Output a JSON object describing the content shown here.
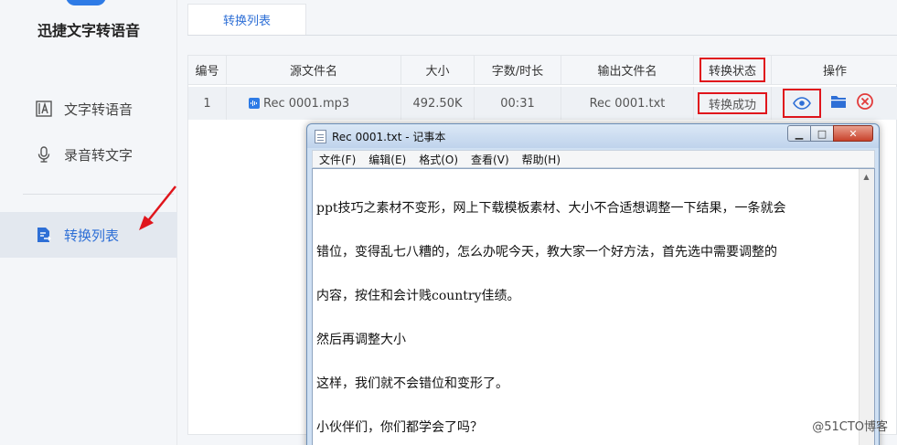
{
  "app": {
    "title": "迅捷文字转语音"
  },
  "sidebar": {
    "items": [
      {
        "label": "文字转语音",
        "icon": "text-box-icon"
      },
      {
        "label": "录音转文字",
        "icon": "microphone-icon"
      },
      {
        "label": "转换列表",
        "icon": "convert-list-icon",
        "active": true
      }
    ]
  },
  "tabs": [
    {
      "label": "转换列表"
    }
  ],
  "table": {
    "headers": [
      "编号",
      "源文件名",
      "大小",
      "字数/时长",
      "输出文件名",
      "转换状态",
      "操作"
    ],
    "rows": [
      {
        "index": "1",
        "source": "Rec 0001.mp3",
        "size": "492.50K",
        "duration": "00:31",
        "output": "Rec 0001.txt",
        "status": "转换成功"
      }
    ],
    "actions": [
      "eye-icon",
      "folder-icon",
      "delete-circle-icon"
    ]
  },
  "notepad": {
    "title": "Rec 0001.txt - 记事本",
    "menu": [
      "文件(F)",
      "编辑(E)",
      "格式(O)",
      "查看(V)",
      "帮助(H)"
    ],
    "lines": [
      "ppt技巧之素材不变形，网上下载模板素材、大小不合适想调整一下结果，一条就会",
      "错位，变得乱七八糟的，怎么办呢今天，教大家一个好方法，首先选中需要调整的",
      "内容，按住和会计贱country佳绩。",
      "然后再调整大小",
      "这样，我们就不会错位和变形了。",
      "小伙伴们，你们都学会了吗？"
    ]
  },
  "watermark": "@51CTO博客",
  "colors": {
    "accent": "#2e6fd6",
    "annotation": "#e0151c",
    "delete": "#e23b3b"
  }
}
